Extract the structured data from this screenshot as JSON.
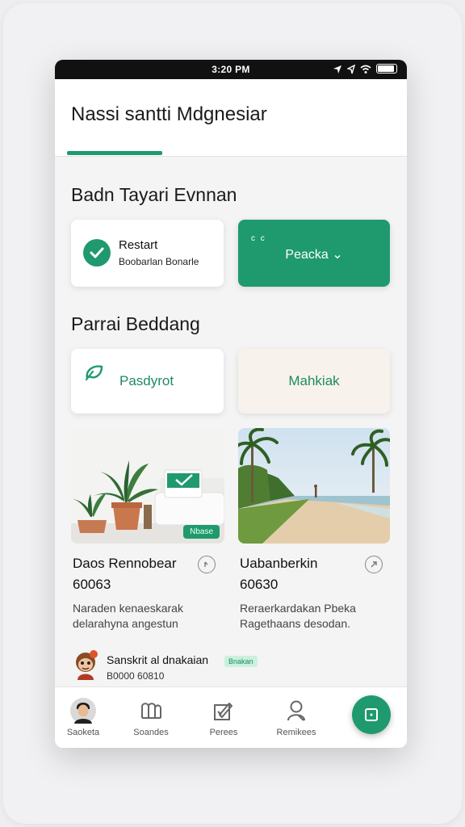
{
  "status_bar": {
    "time": "3:20 PM"
  },
  "header": {
    "title": "Nassi santti Mdgnesiar"
  },
  "section1": {
    "title": "Badn Tayari Evnnan"
  },
  "restart_card": {
    "title": "Restart",
    "subtitle": "Boobarlan Bonarle"
  },
  "peacka_button": {
    "dots": "c c",
    "label": "Peacka ⌄"
  },
  "section2": {
    "title": "Parrai Beddang"
  },
  "categories": [
    {
      "label": "Pasdyrot"
    },
    {
      "label": "Mahkiak"
    }
  ],
  "items": [
    {
      "badge": "Nbase",
      "title": "Daos Rennobear",
      "price": "60063",
      "desc_line1": "Naraden kenaeskarak",
      "desc_line2": "delarahyna angestun"
    },
    {
      "title": "Uabanberkin",
      "price": "60630",
      "desc_line1": "Reraerkardakan Pbeka",
      "desc_line2": "Ragethaans desodan."
    }
  ],
  "review": {
    "name": "Sanskrit al dnakaian",
    "tag": "Bnakan",
    "date": "B0000 60810"
  },
  "bottom_nav": [
    {
      "label": "Saoketa"
    },
    {
      "label": "Soandes"
    },
    {
      "label": "Perees"
    },
    {
      "label": "Remikees"
    }
  ],
  "colors": {
    "accent": "#1f9a6e",
    "background": "#f4f4f4"
  }
}
